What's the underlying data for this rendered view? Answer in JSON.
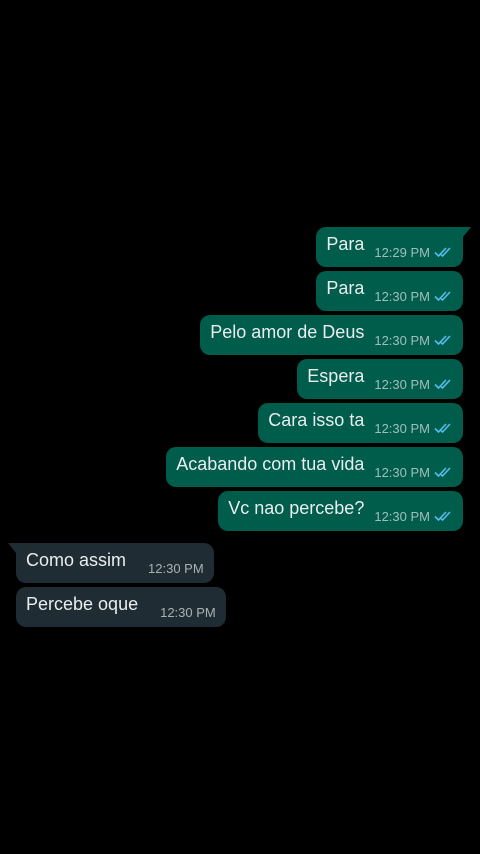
{
  "colors": {
    "background": "#000000",
    "outgoing_bubble": "#005c4b",
    "incoming_bubble": "#1f2c34",
    "read_ticks": "#53bdeb"
  },
  "messages": [
    {
      "direction": "out",
      "text": "Para",
      "time": "12:29 PM",
      "status": "read-ticks-icon"
    },
    {
      "direction": "out",
      "text": "Para",
      "time": "12:30 PM",
      "status": "read-ticks-icon"
    },
    {
      "direction": "out",
      "text": "Pelo amor de Deus",
      "time": "12:30 PM",
      "status": "read-ticks-icon"
    },
    {
      "direction": "out",
      "text": "Espera",
      "time": "12:30 PM",
      "status": "read-ticks-icon"
    },
    {
      "direction": "out",
      "text": "Cara isso ta",
      "time": "12:30 PM",
      "status": "read-ticks-icon"
    },
    {
      "direction": "out",
      "text": "Acabando com tua vida",
      "time": "12:30 PM",
      "status": "read-ticks-icon"
    },
    {
      "direction": "out",
      "text": "Vc nao percebe?",
      "time": "12:30 PM",
      "status": "read-ticks-icon"
    },
    {
      "direction": "in",
      "text": "Como assim",
      "time": "12:30 PM"
    },
    {
      "direction": "in",
      "text": "Percebe oque",
      "time": "12:30 PM"
    }
  ]
}
